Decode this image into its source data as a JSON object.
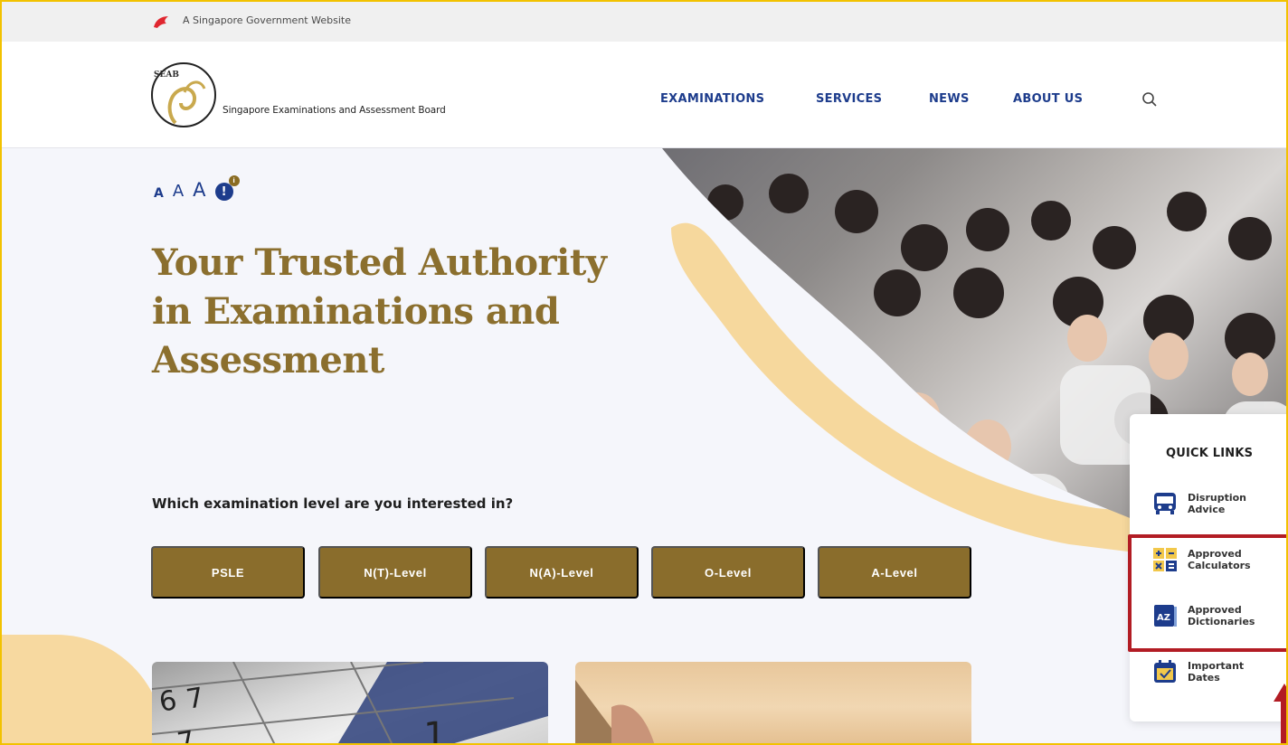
{
  "gov_banner": {
    "text": "A Singapore Government Website"
  },
  "logo": {
    "abbr": "SEAB",
    "name": "Singapore Examinations and Assessment Board"
  },
  "nav": {
    "items": [
      {
        "label": "EXAMINATIONS"
      },
      {
        "label": "SERVICES"
      },
      {
        "label": "NEWS"
      },
      {
        "label": "ABOUT US"
      }
    ]
  },
  "font_controls": {
    "small": "A",
    "medium": "A",
    "large": "A",
    "info": "!",
    "info_badge": "i"
  },
  "hero": {
    "title_line1": "Your Trusted Authority",
    "title_line2": "in Examinations and",
    "title_line3": "Assessment"
  },
  "exam_question": "Which examination level are you interested in?",
  "levels": [
    {
      "label": "PSLE"
    },
    {
      "label": "N(T)-Level"
    },
    {
      "label": "N(A)-Level"
    },
    {
      "label": "O-Level"
    },
    {
      "label": "A-Level"
    }
  ],
  "quick_links": {
    "title": "QUICK LINKS",
    "items": [
      {
        "line1": "Disruption",
        "line2": "Advice",
        "icon": "bus-icon"
      },
      {
        "line1": "Approved",
        "line2": "Calculators",
        "icon": "calculator-icon"
      },
      {
        "line1": "Approved",
        "line2": "Dictionaries",
        "icon": "dictionary-icon"
      },
      {
        "line1": "Important",
        "line2": "Dates",
        "icon": "calendar-icon"
      }
    ]
  },
  "colors": {
    "brand_gold": "#8a6d2c",
    "nav_blue": "#1d3c8c",
    "highlight_red": "#b21c24"
  }
}
